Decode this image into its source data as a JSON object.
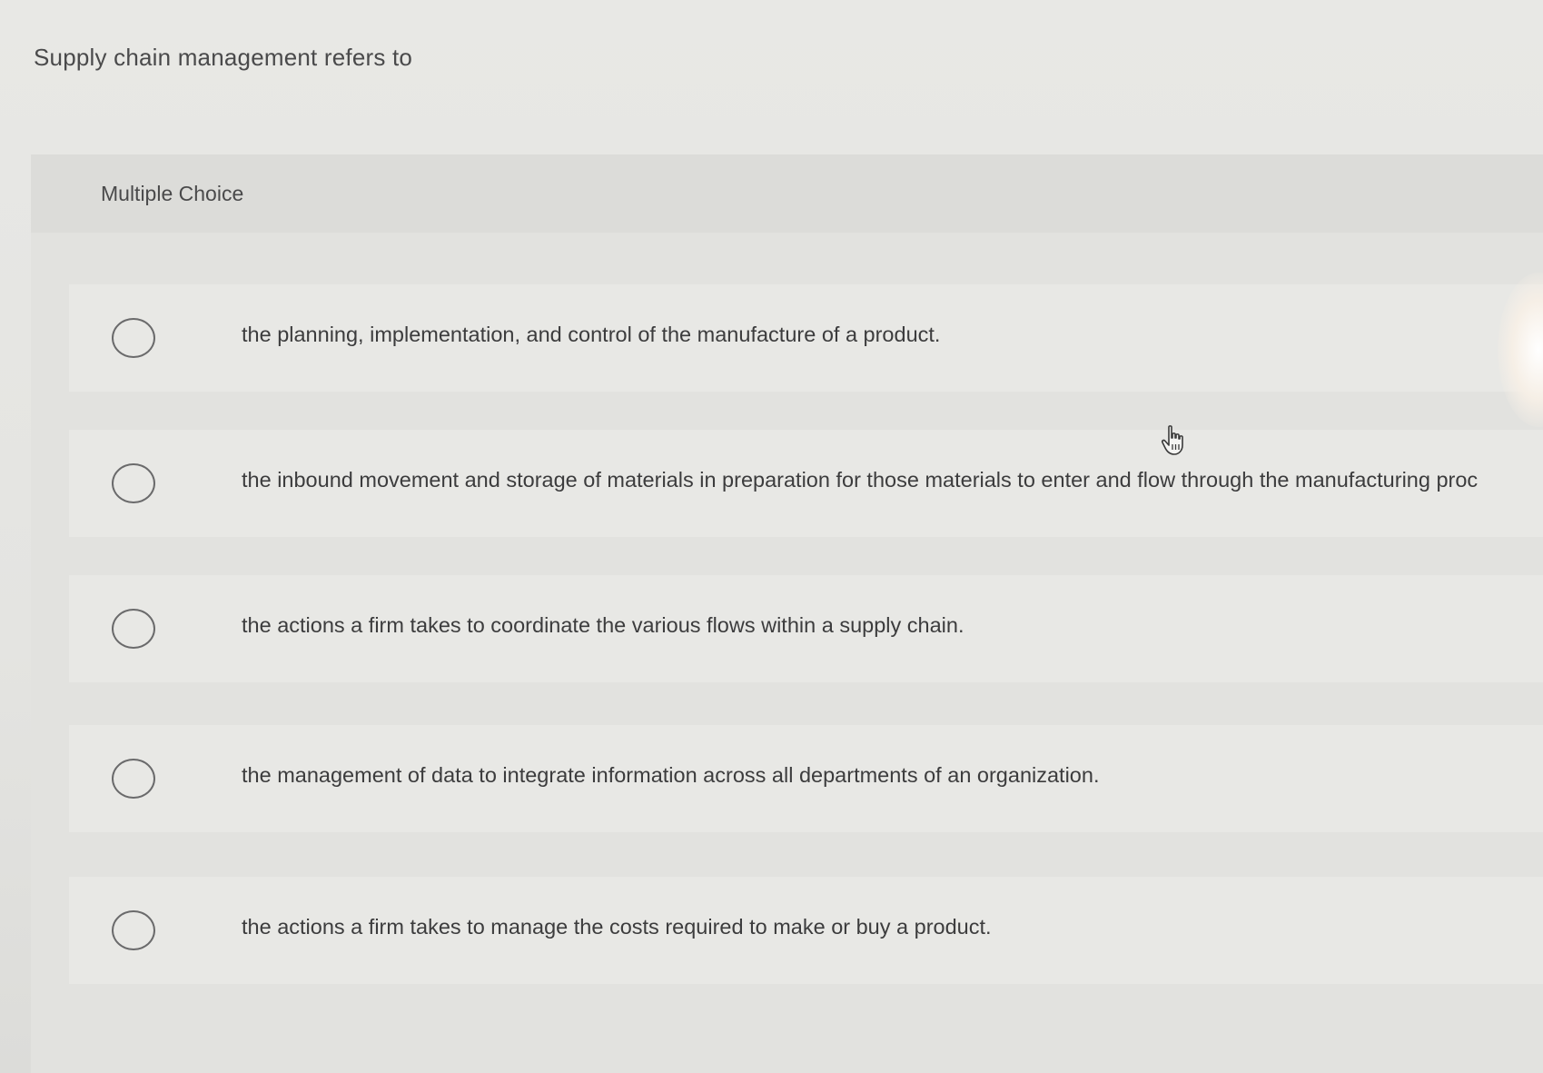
{
  "question": {
    "text": "Supply chain management refers to"
  },
  "panel": {
    "type_label": "Multiple Choice"
  },
  "options": [
    {
      "label": "the planning, implementation, and control of the manufacture of a product."
    },
    {
      "label": "the inbound movement and storage of materials in preparation for those materials to enter and flow through the manufacturing proc"
    },
    {
      "label": "the actions a firm takes to coordinate the various flows within a supply chain."
    },
    {
      "label": "the management of data to integrate information across all departments of an organization."
    },
    {
      "label": "the actions a firm takes to manage the costs required to make or buy a product."
    }
  ],
  "icons": {
    "radio": "radio-unselected-icon",
    "cursor": "hand-pointer-icon"
  },
  "colors": {
    "background": "#e6e6e3",
    "text": "#3f3f40",
    "radio_border": "#6a6a6b"
  }
}
